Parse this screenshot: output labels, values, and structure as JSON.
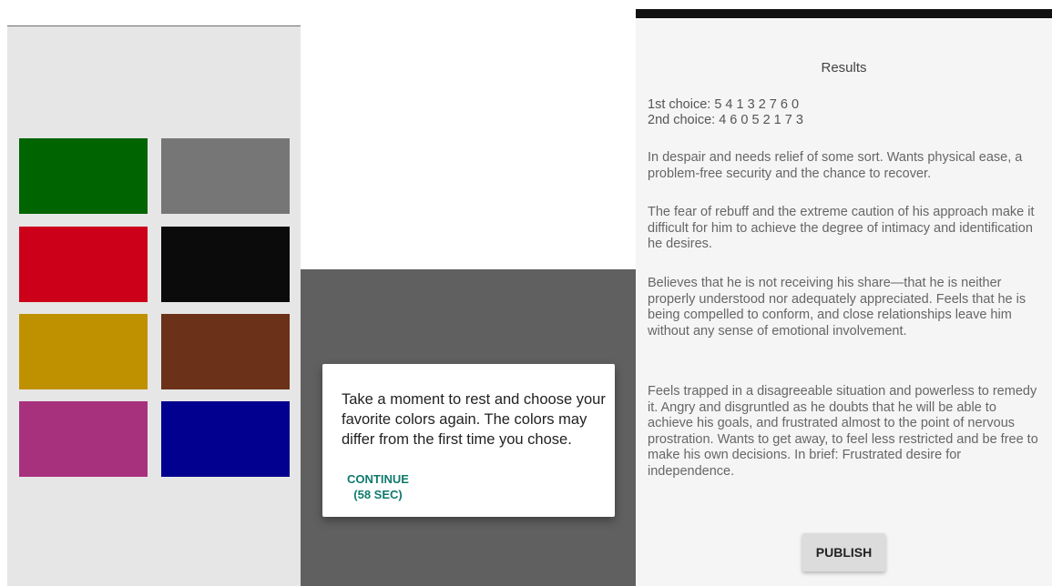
{
  "color_grid": {
    "swatches": [
      {
        "color": "#006400"
      },
      {
        "color": "#767676"
      },
      {
        "color": "#cc0018"
      },
      {
        "color": "#0b0b0b"
      },
      {
        "color": "#bf9100"
      },
      {
        "color": "#6b3119"
      },
      {
        "color": "#a8317e"
      },
      {
        "color": "#02008e"
      }
    ]
  },
  "dialog": {
    "message": "Take a moment to rest and choose your favorite colors again. The colors may differ from the first time you chose.",
    "action_label": "CONTINUE",
    "action_timer": "(58 SEC)"
  },
  "results": {
    "title": "Results",
    "first_choice": "1st choice: 5 4 1 3 2 7 6 0",
    "second_choice": "2nd choice: 4 6 0 5 2 1 7 3",
    "paragraphs": [
      "In despair and needs relief of some sort. Wants physical ease, a problem-free security and the chance to recover.",
      "The fear of rebuff and the extreme caution of his approach make it difficult for him to achieve the degree of intimacy and identification he desires.",
      "Believes that he is not receiving his share—that he is neither properly understood nor adequately appreciated. Feels that he is being compelled to conform, and close relationships leave him without any sense of emotional involvement.",
      "Feels trapped in a disagreeable situation and powerless to remedy it. Angry and disgruntled as he doubts that he will be able to achieve his goals, and frustrated almost to the point of nervous prostration. Wants to get away, to feel less restricted and be free to make his own decisions. In brief: Frustrated desire for independence."
    ],
    "publish_label": "PUBLISH"
  }
}
